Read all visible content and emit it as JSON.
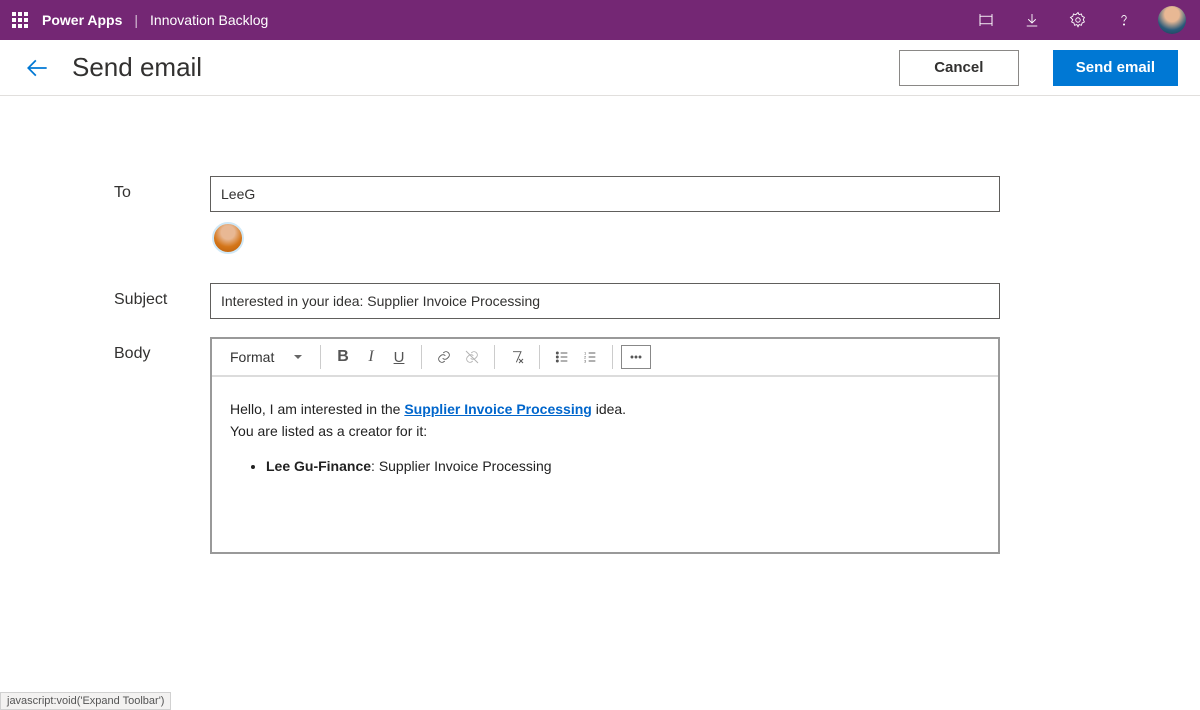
{
  "titlebar": {
    "product": "Power Apps",
    "separator": "|",
    "app_name": "Innovation Backlog"
  },
  "page": {
    "title": "Send email",
    "cancel_label": "Cancel",
    "send_label": "Send email"
  },
  "form": {
    "to_label": "To",
    "to_value": "LeeG",
    "subject_label": "Subject",
    "subject_value": "Interested in your idea: Supplier Invoice Processing",
    "body_label": "Body"
  },
  "toolbar": {
    "format_label": "Format"
  },
  "body": {
    "line1_pre": "Hello, I am interested in the ",
    "line1_link": "Supplier Invoice Processing",
    "line1_post": " idea.",
    "line2": "You are listed as a creator for it:",
    "bullet_name": "Lee Gu-Finance",
    "bullet_sep": ": ",
    "bullet_rest": "Supplier Invoice Processing"
  },
  "status_tip": "javascript:void('Expand Toolbar')"
}
